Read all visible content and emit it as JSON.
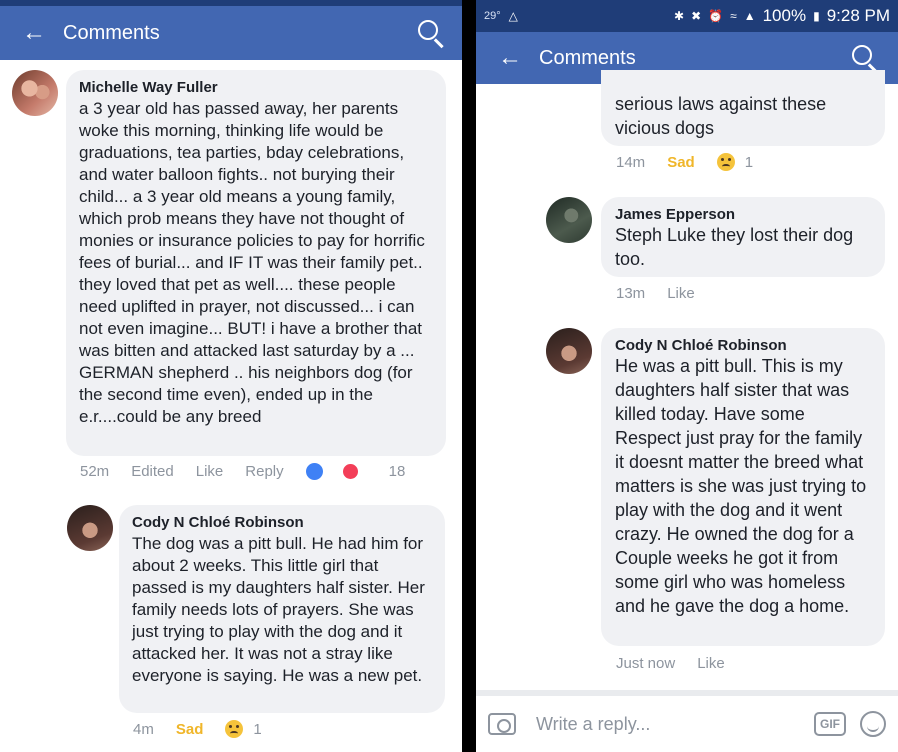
{
  "left": {
    "header": {
      "title": "Comments"
    },
    "comments": [
      {
        "author": "Michelle Way Fuller",
        "text": "a 3 year old has passed away, her parents woke this morning, thinking life would be graduations, tea parties, bday celebrations, and water balloon fights.. not burying their child... a 3 year old means a young family, which prob means they  have not thought of monies or insurance policies to pay for horrific fees of burial... and IF IT was their family pet.. they loved that pet as well.... these people need uplifted in prayer, not discussed... i can not even imagine...  BUT! i have a brother that was bitten and attacked last saturday by a ... GERMAN shepherd .. his neighbors dog (for the second time even), ended up in the e.r....could be any breed",
        "time": "52m",
        "edited": "Edited",
        "like": "Like",
        "reply": "Reply",
        "reaction_count": "18"
      },
      {
        "author": "Cody N Chloé Robinson",
        "text": "The dog was a pitt bull. He had him for about 2 weeks. This little girl that passed is my daughters half sister. Her family needs lots of prayers. She was just trying to play with the dog and it attacked her. It was not a stray like everyone is saying. He was a new pet.",
        "time": "4m",
        "reaction_label": "Sad",
        "reaction_count": "1"
      }
    ]
  },
  "right": {
    "status": {
      "temp": "29°",
      "battery": "100%",
      "time": "9:28 PM"
    },
    "header": {
      "title": "Comments"
    },
    "comments": [
      {
        "partial_text": "serious laws against these vicious dogs",
        "time": "14m",
        "reaction_label": "Sad",
        "reaction_count": "1"
      },
      {
        "author": "James Epperson",
        "text": "Steph Luke they lost their dog too.",
        "time": "13m",
        "like": "Like"
      },
      {
        "author": "Cody N Chloé Robinson",
        "text": "He was a pitt bull. This is my daughters half sister that was killed today. Have some Respect just pray for the family it doesnt matter the breed what matters is she was just trying to play with the dog and it went crazy. He owned the dog for a Couple weeks he got it from some girl who was homeless and he gave the dog a home.",
        "time": "Just now",
        "like": "Like"
      }
    ],
    "composer": {
      "placeholder": "Write a reply...",
      "gif": "GIF"
    }
  }
}
